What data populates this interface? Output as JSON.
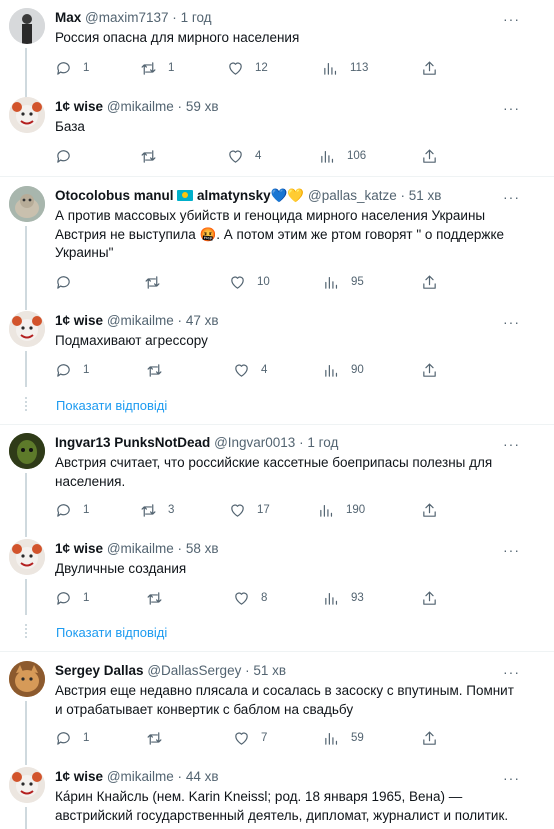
{
  "tweets": [
    {
      "name": "Max",
      "handle": "@maxim7137",
      "sep": "·",
      "time": "1 год",
      "text": "Россия опасна для мирного населения",
      "replies": "1",
      "retweets": "1",
      "likes": "12",
      "views": "113"
    },
    {
      "name": "1¢ wise",
      "handle": "@mikailme",
      "sep": "·",
      "time": "59 хв",
      "text": "База",
      "replies": "",
      "retweets": "",
      "likes": "4",
      "views": "106"
    },
    {
      "name": "Otocolobus manul",
      "name_suffix": "almatynsky💙💛",
      "handle": "@pallas_katze",
      "sep": "·",
      "time": "51 хв",
      "text": "А против массовых  убийств и геноцида мирного населения Украины Австрия  не выступила 🤬. А потом этим же ртом говорят \" о поддержке Украины\"",
      "replies": "",
      "retweets": "",
      "likes": "10",
      "views": "95"
    },
    {
      "name": "1¢ wise",
      "handle": "@mikailme",
      "sep": "·",
      "time": "47 хв",
      "text": "Подмахивают агрессору",
      "replies": "1",
      "retweets": "",
      "likes": "4",
      "views": "90"
    },
    {
      "name": "Ingvar13 PunksNotDead",
      "handle": "@Ingvar0013",
      "sep": "·",
      "time": "1 год",
      "text": "Австрия считает, что российские кассетные боеприпасы полезны для населения.",
      "replies": "1",
      "retweets": "3",
      "likes": "17",
      "views": "190"
    },
    {
      "name": "1¢ wise",
      "handle": "@mikailme",
      "sep": "·",
      "time": "58 хв",
      "text": "Двуличные создания",
      "replies": "1",
      "retweets": "",
      "likes": "8",
      "views": "93"
    },
    {
      "name": "Sergey Dallas",
      "handle": "@DallasSergey",
      "sep": "·",
      "time": "51 хв",
      "text": "Австрия еще недавно плясала и сосалась в засоску с впутиным. Помнит и отрабатывает конвертик с баблом на свадьбу",
      "replies": "1",
      "retweets": "",
      "likes": "7",
      "views": "59"
    },
    {
      "name": "1¢ wise",
      "handle": "@mikailme",
      "sep": "·",
      "time": "44 хв",
      "text": "Ка́рин Кнайсль (нем. Karin Kneissl; род. 18 января 1965, Вена) — австрийский государственный деятель, дипломат, журналист и политик."
    }
  ],
  "show_replies": "Показати відповіді",
  "more_glyph": "···",
  "colors": {
    "link": "#1d9bf0",
    "muted": "#536471",
    "divider": "#eff3f4"
  }
}
